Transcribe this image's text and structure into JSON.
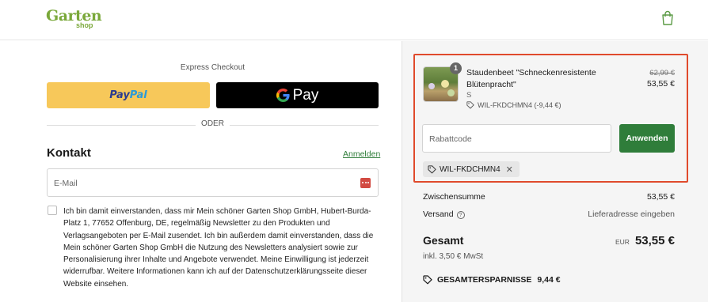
{
  "header": {
    "logo_main": "Garten",
    "logo_sub": "shop"
  },
  "express": {
    "title": "Express Checkout",
    "paypal_pay": "Pay",
    "paypal_pal": "Pal",
    "gpay_label": "Pay",
    "divider": "ODER"
  },
  "contact": {
    "heading": "Kontakt",
    "login_link": "Anmelden",
    "email_placeholder": "E-Mail",
    "consent_text": "Ich bin damit einverstanden, dass mir Mein schöner Garten Shop GmbH, Hubert-Burda-Platz 1, 77652 Offenburg, DE, regelmäßig Newsletter zu den Produkten und Verlagsangeboten per E-Mail zusendet. Ich bin außerdem damit einverstanden, dass die Mein schöner Garten Shop GmbH die Nutzung des Newsletters analysiert sowie zur Personalisierung ihrer Inhalte und Angebote verwendet. Meine Einwilligung ist jederzeit widerrufbar. Weitere Informationen kann ich auf der Datenschutzerklärungsseite dieser Website einsehen."
  },
  "cart": {
    "item": {
      "quantity": "1",
      "name": "Staudenbeet \"Schneckenresistente Blütenpracht\"",
      "variant": "S",
      "discount_line": "WIL-FKDCHMN4 (-9,44 €)",
      "old_price": "62,99 €",
      "price": "53,55 €"
    },
    "discount_placeholder": "Rabattcode",
    "apply_label": "Anwenden",
    "applied_code": "WIL-FKDCHMN4"
  },
  "summary": {
    "subtotal_label": "Zwischensumme",
    "subtotal_value": "53,55 €",
    "shipping_label": "Versand",
    "shipping_value": "Lieferadresse eingeben",
    "total_label": "Gesamt",
    "currency": "EUR",
    "total_value": "53,55 €",
    "tax_note": "inkl. 3,50 € MwSt",
    "savings_label": "GESAMTERSPARNISSE",
    "savings_value": "9,44 €"
  },
  "colors": {
    "brand_green": "#7aa83a",
    "button_green": "#2f7d3a",
    "highlight_red": "#e04a2c",
    "paypal_yellow": "#f7c85a"
  }
}
